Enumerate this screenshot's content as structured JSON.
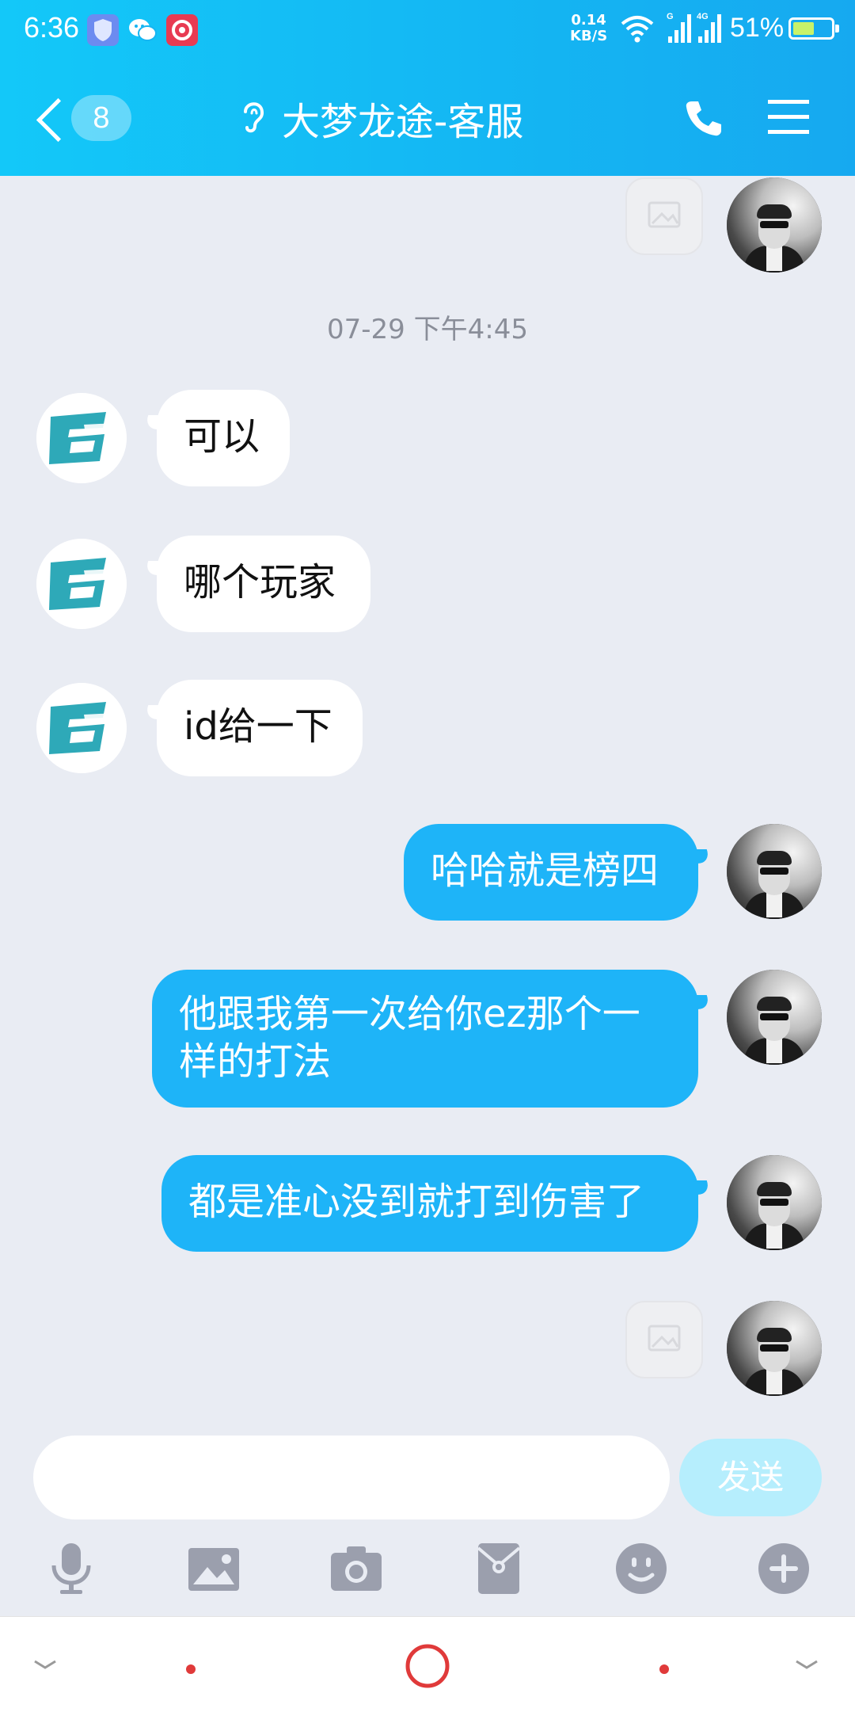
{
  "status_bar": {
    "time": "6:36",
    "net_speed_value": "0.14",
    "net_speed_unit": "KB/S",
    "battery_percent": "51%"
  },
  "header": {
    "back_count": "8",
    "title": "大梦龙途-客服"
  },
  "messages": [
    {
      "side": "out",
      "type": "image"
    },
    {
      "type": "timestamp",
      "text": "07-29 下午4:45"
    },
    {
      "side": "in",
      "text": "可以"
    },
    {
      "side": "in",
      "text": "哪个玩家"
    },
    {
      "side": "in",
      "text": "id给一下"
    },
    {
      "side": "out",
      "text": "哈哈就是榜四"
    },
    {
      "side": "out",
      "text_line1": "他跟我第一次给你ez那个一",
      "text_line2": "样的打法"
    },
    {
      "side": "out",
      "text": "都是准心没到就打到伤害了"
    },
    {
      "side": "out",
      "type": "image"
    }
  ],
  "composer": {
    "input_value": "",
    "send_label": "发送"
  },
  "toolbar": [
    "mic-icon",
    "image-icon",
    "camera-icon",
    "red-packet-icon",
    "emoji-icon",
    "plus-icon"
  ],
  "colors": {
    "header_blue": "#14b7f3",
    "out_bubble": "#1eb4f8",
    "background": "#e9ecf3",
    "send_disabled": "#b6eefd"
  }
}
